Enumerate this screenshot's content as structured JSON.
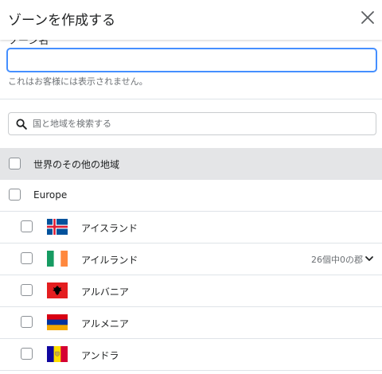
{
  "modal": {
    "title": "ゾーンを作成する",
    "close_icon": "close-icon"
  },
  "zone_name": {
    "label": "ゾーン名",
    "value": "",
    "placeholder": "",
    "help": "これはお客様には表示されません。"
  },
  "search": {
    "placeholder": "国と地域を検索する",
    "icon": "search-icon"
  },
  "rest_of_world": {
    "label": "世界のその他の地域"
  },
  "region": {
    "label": "Europe"
  },
  "countries": [
    {
      "name": "アイスランド",
      "flag": "iceland-flag-icon"
    },
    {
      "name": "アイルランド",
      "flag": "ireland-flag-icon",
      "meta": "26個中0の郡"
    },
    {
      "name": "アルバニア",
      "flag": "albania-flag-icon"
    },
    {
      "name": "アルメニア",
      "flag": "armenia-flag-icon"
    },
    {
      "name": "アンドラ",
      "flag": "andorra-flag-icon"
    }
  ],
  "colors": {
    "focus_border": "#458fff",
    "row_highlight": "#e4e5e7",
    "divider": "#dfe3e8"
  }
}
